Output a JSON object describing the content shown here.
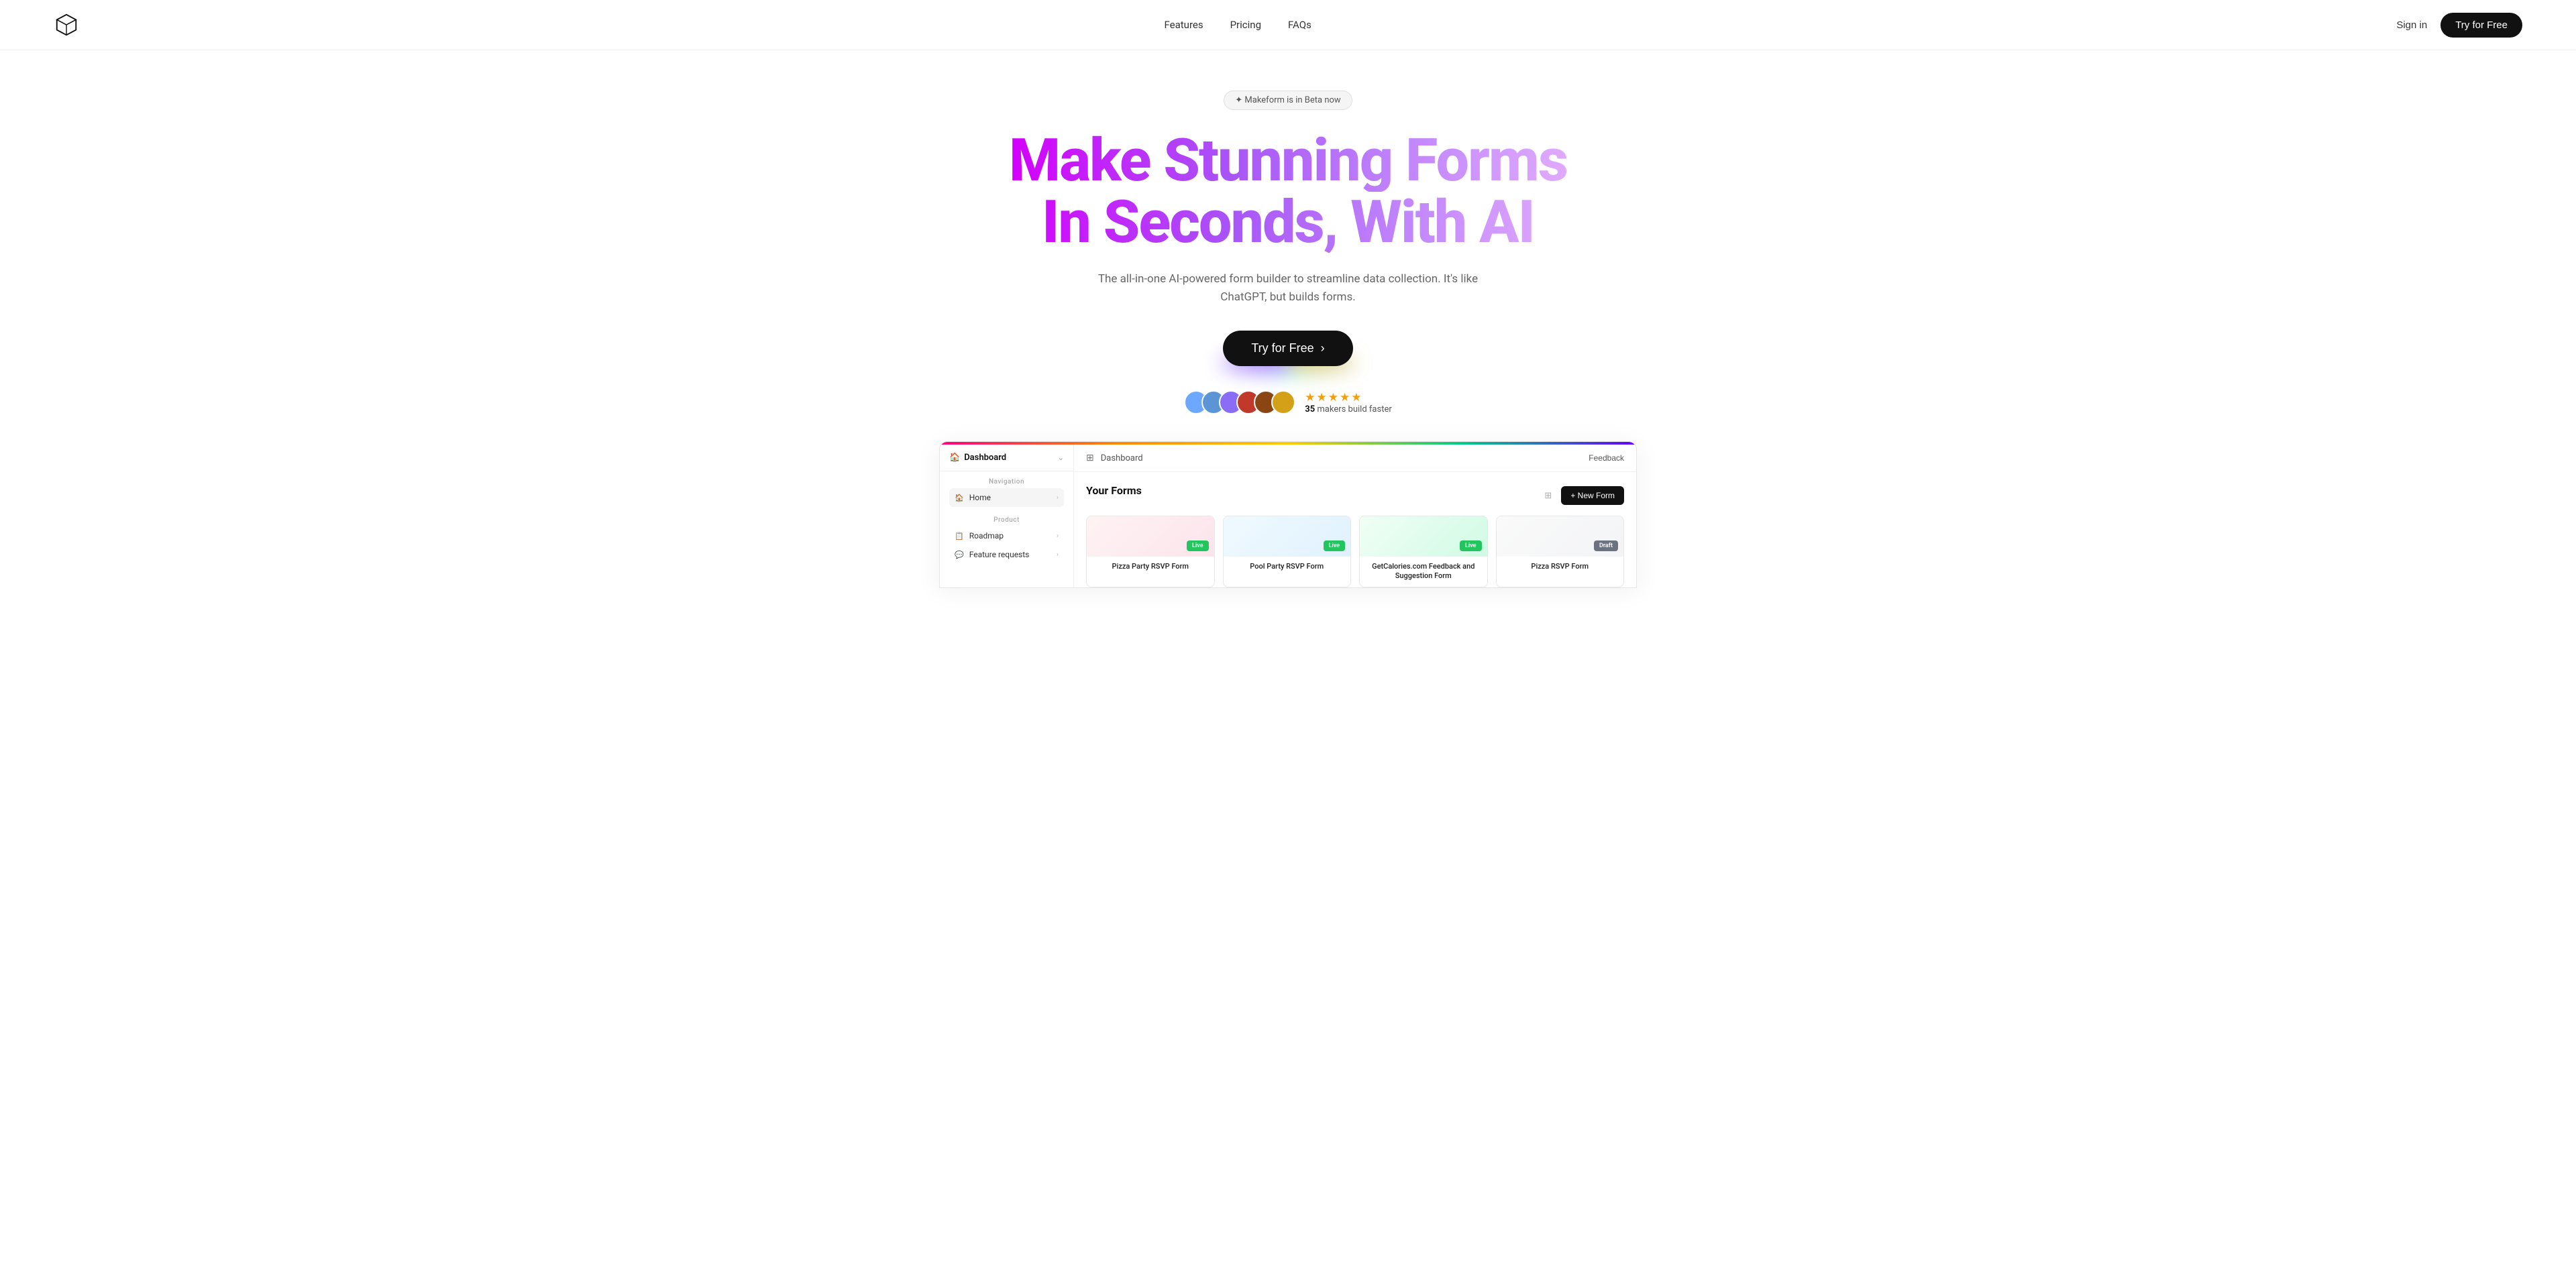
{
  "nav": {
    "logo_alt": "Makeform logo",
    "links": [
      {
        "label": "Features",
        "id": "features"
      },
      {
        "label": "Pricing",
        "id": "pricing"
      },
      {
        "label": "FAQs",
        "id": "faqs"
      }
    ],
    "sign_in": "Sign in",
    "try_free": "Try for Free"
  },
  "hero": {
    "beta_badge": "✦ Makeform is in Beta now",
    "title_line1": "Make Stunning Forms",
    "title_line2": "In Seconds, With AI",
    "subtitle": "The all-in-one AI-powered form builder to streamline data collection. It's like ChatGPT, but builds forms.",
    "cta_label": "Try for Free",
    "cta_arrow": "›",
    "social_count": "35",
    "social_suffix": "makers build faster",
    "stars": "★★★★★"
  },
  "dashboard": {
    "sidebar": {
      "title": "Dashboard",
      "nav_section_label": "Navigation",
      "product_section_label": "Product",
      "nav_items": [
        {
          "label": "Home",
          "icon": "🏠",
          "section": "nav",
          "active": true
        },
        {
          "label": "Roadmap",
          "icon": "📋",
          "section": "product"
        },
        {
          "label": "Feature requests",
          "icon": "💬",
          "section": "product"
        }
      ]
    },
    "main": {
      "breadcrumb": "Dashboard",
      "feedback_label": "Feedback",
      "your_forms_label": "Your Forms",
      "new_form_label": "+ New Form",
      "forms": [
        {
          "name": "Pizza Party RSVP Form",
          "badge": "Live",
          "badge_type": "live"
        },
        {
          "name": "Pool Party RSVP Form",
          "badge": "Live",
          "badge_type": "live"
        },
        {
          "name": "GetCalories.com Feedback and Suggestion Form",
          "badge": "Live",
          "badge_type": "live"
        },
        {
          "name": "Pizza RSVP Form",
          "badge": "Draft",
          "badge_type": "draft"
        }
      ]
    }
  },
  "avatars": [
    {
      "color": "#6ea8fe",
      "initial": ""
    },
    {
      "color": "#5c7fbf",
      "initial": ""
    },
    {
      "color": "#8b6cf7",
      "initial": ""
    },
    {
      "color": "#c0392b",
      "initial": ""
    },
    {
      "color": "#8b4513",
      "initial": ""
    },
    {
      "color": "#d4a017",
      "initial": ""
    }
  ]
}
